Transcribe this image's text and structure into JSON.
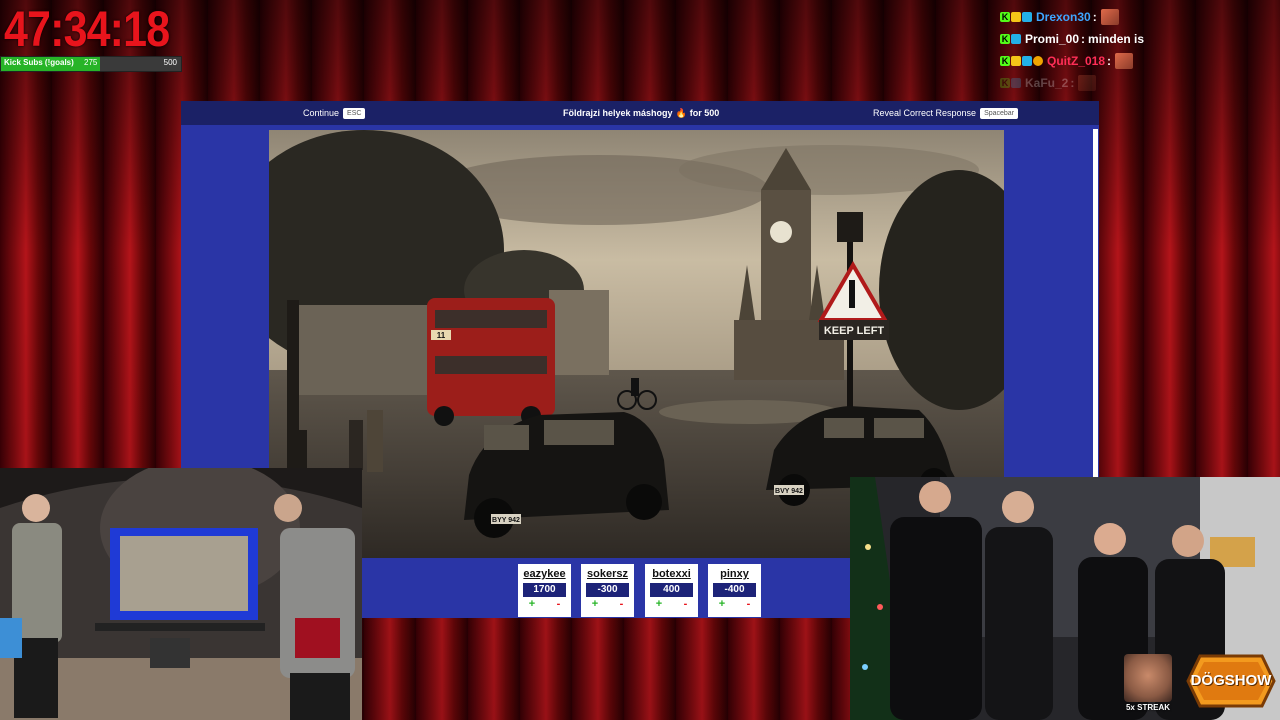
{
  "timer": {
    "text": "47:34:18"
  },
  "goal": {
    "label": "Kick Subs (!goals)",
    "current": "275",
    "target": "500",
    "fraction": 0.55,
    "color": "#27b427"
  },
  "chat": [
    {
      "user": "Drexon30",
      "message": "",
      "user_color": "#3ea6ff",
      "badges": [
        "kick",
        "crown",
        "gift"
      ],
      "emote": true,
      "faded": false
    },
    {
      "user": "Promi_00",
      "message": "minden is",
      "user_color": "#ffffff",
      "badges": [
        "kick",
        "gift"
      ],
      "emote": false,
      "faded": false
    },
    {
      "user": "QuitZ_018",
      "message": "",
      "user_color": "#ff2e57",
      "badges": [
        "kick",
        "crown",
        "gift",
        "sub"
      ],
      "emote": true,
      "faded": false
    },
    {
      "user": "KaFu_2",
      "message": "",
      "user_color": "#ffffff",
      "badges": [
        "kick",
        "gift"
      ],
      "emote": true,
      "faded": true
    }
  ],
  "quiz": {
    "continue_label": "Continue",
    "continue_key": "ESC",
    "title": "Földrajzi helyek máshogy",
    "title_suffix": "for 500",
    "reveal_label": "Reveal Correct Response",
    "reveal_key": "Spacebar"
  },
  "photo": {
    "sign_text": "KEEP LEFT",
    "bus_number": "11",
    "plate_left": "BYY 942",
    "plate_right": "BVY 942"
  },
  "scores": [
    {
      "name": "eazykee",
      "value": "1700"
    },
    {
      "name": "sokersz",
      "value": "-300"
    },
    {
      "name": "botexxi",
      "value": "400"
    },
    {
      "name": "pinxy",
      "value": "-400"
    }
  ],
  "score_buttons": {
    "plus": "+",
    "minus": "-"
  },
  "streak": {
    "label": "5x STREAK"
  },
  "logo": {
    "text": "DÖGSHOW"
  },
  "colors": {
    "panel": "#2a35a6",
    "panel_bar": "#1b2166",
    "timer": "#e8141c"
  }
}
